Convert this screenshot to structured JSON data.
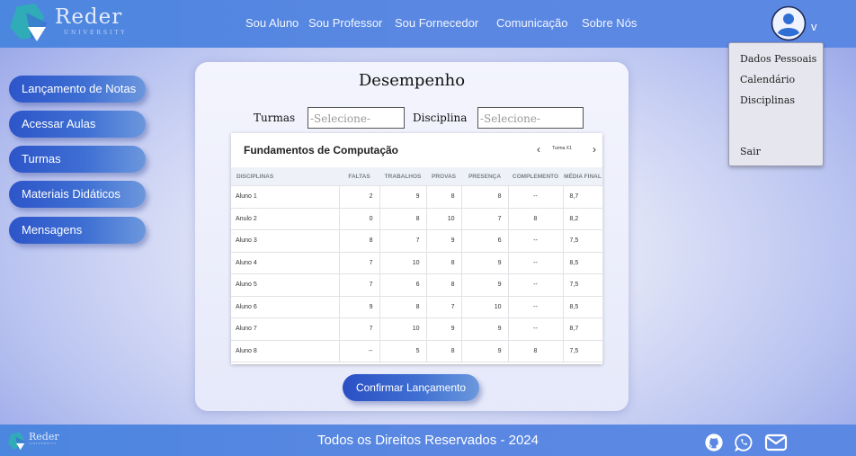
{
  "brand": {
    "name": "Reder",
    "subtitle": "UNIVERSITY"
  },
  "nav": [
    "Sou Aluno",
    "Sou Professor",
    "Sou Fornecedor",
    "Comunicação",
    "Sobre Nós"
  ],
  "user_menu": {
    "chevron": "v",
    "items": [
      "Dados Pessoais",
      "Calendário",
      "Disciplinas"
    ],
    "logout": "Sair"
  },
  "sidebar": [
    "Lançamento de Notas",
    "Acessar Aulas",
    "Turmas",
    "Materiais Didáticos",
    "Mensagens"
  ],
  "panel": {
    "title": "Desempenho",
    "turmas_label": "Turmas",
    "turmas_placeholder": "-Selecione-",
    "disciplina_label": "Disciplina",
    "disciplina_placeholder": "-Selecione-",
    "table_title": "Fundamentos de Computação",
    "turma": {
      "prev": "‹",
      "label": "Turma X1",
      "next": "›"
    },
    "columns": [
      "DISCIPLINAS",
      "FALTAS",
      "TRABALHOS",
      "PROVAS",
      "PRESENÇA",
      "COMPLEMENTO",
      "MÉDIA FINAL"
    ],
    "rows": [
      [
        "Aluno 1",
        "2",
        "9",
        "8",
        "8",
        "--",
        "8,7"
      ],
      [
        "Anulo 2",
        "0",
        "8",
        "10",
        "7",
        "8",
        "8,2"
      ],
      [
        "Aluno 3",
        "8",
        "7",
        "9",
        "6",
        "--",
        "7,5"
      ],
      [
        "Aluno 4",
        "7",
        "10",
        "8",
        "9",
        "--",
        "8,5"
      ],
      [
        "Aluno 5",
        "7",
        "6",
        "8",
        "9",
        "--",
        "7,5"
      ],
      [
        "Aluno 6",
        "9",
        "8",
        "7",
        "10",
        "--",
        "8,5"
      ],
      [
        "Aluno 7",
        "7",
        "10",
        "9",
        "9",
        "--",
        "8,7"
      ],
      [
        "Aluno 8",
        "--",
        "5",
        "8",
        "9",
        "8",
        "7,5"
      ]
    ],
    "confirm": "Confirmar Lançamento"
  },
  "footer": {
    "text": "Todos os Direitos Reservados - 2024",
    "icons": [
      "github-icon",
      "whatsapp-icon",
      "mail-icon"
    ]
  },
  "colors": {
    "header": "#5a87e2",
    "button": "#2d55c9",
    "accent": "#6c97dd"
  }
}
